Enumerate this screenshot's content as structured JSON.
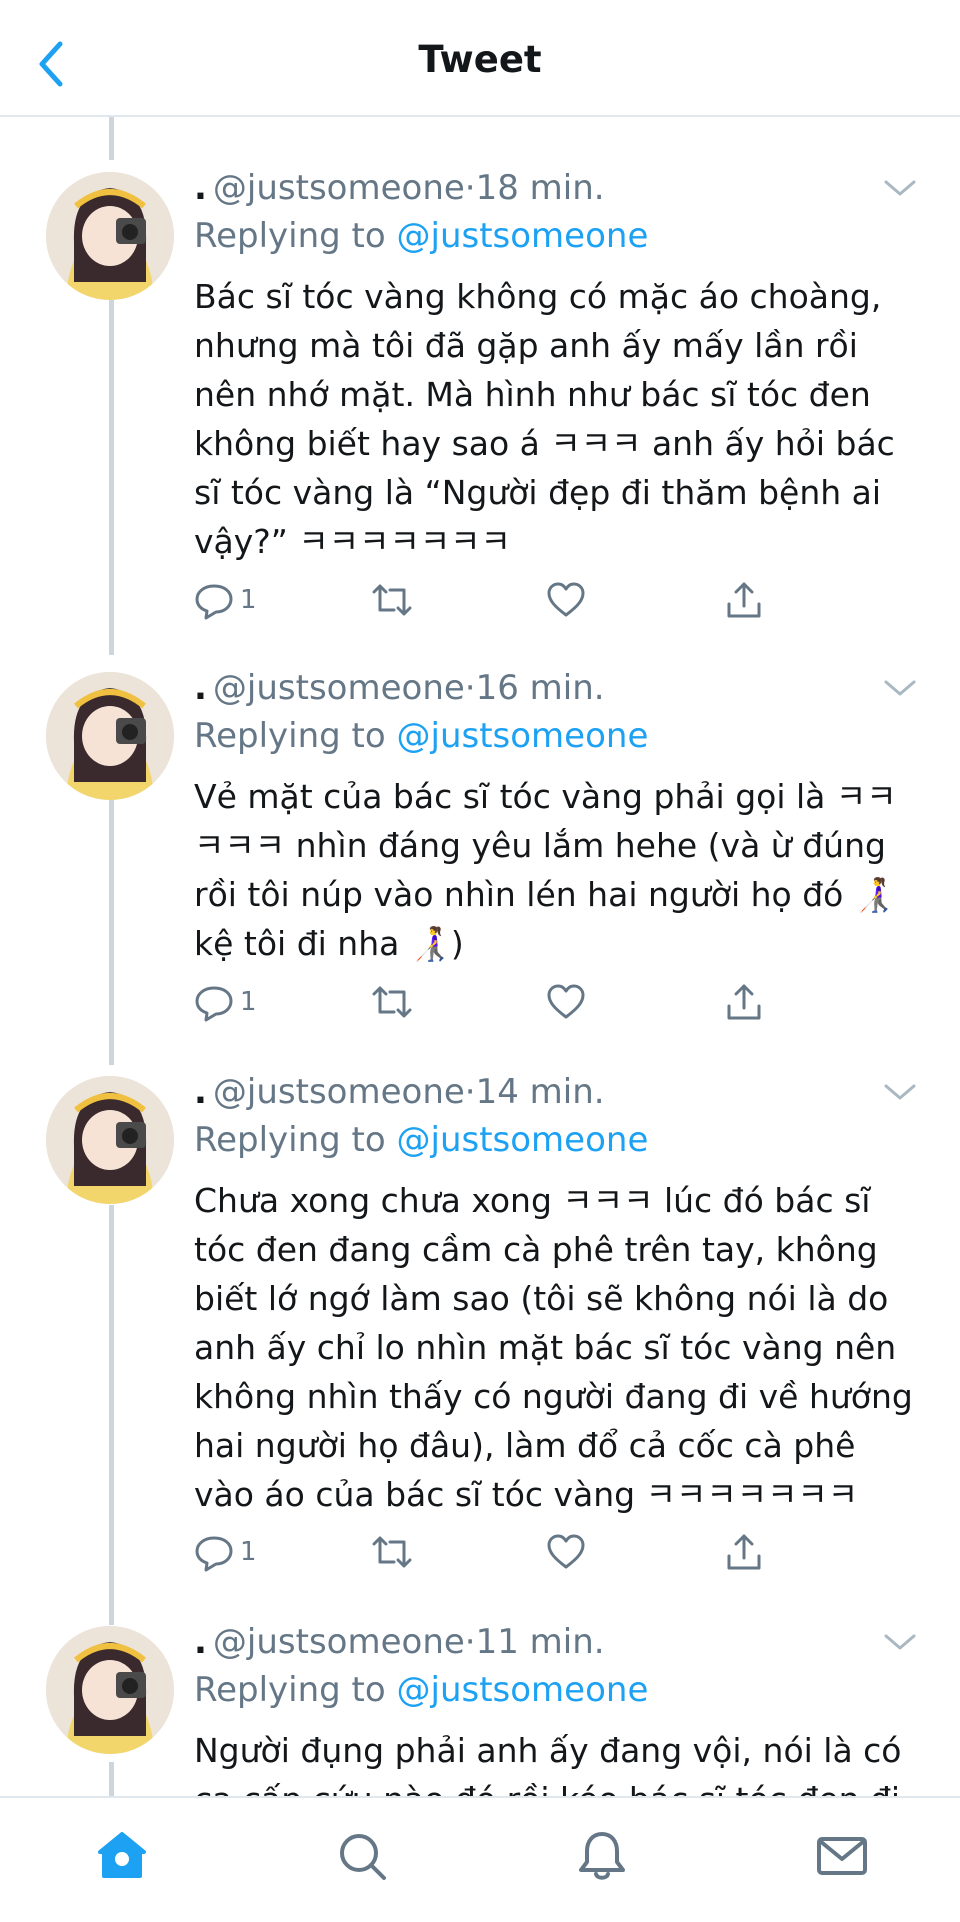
{
  "header": {
    "title": "Tweet"
  },
  "tweets": [
    {
      "dot": ".",
      "handle": "@justsomeone",
      "sep": "·",
      "time": "18 min.",
      "replying_prefix": "Replying to",
      "replying_handle": "@justsomeone",
      "text": "Bác sĩ tóc vàng không có mặc áo choàng, nhưng mà tôi đã gặp anh ấy mấy lần rồi nên nhớ mặt. Mà hình như bác sĩ tóc đen không biết hay sao á ㅋㅋㅋ anh ấy hỏi bác sĩ tóc vàng là “Người đẹp đi thăm bệnh ai vậy?” ㅋㅋㅋㅋㅋㅋㅋ",
      "reply_count": "1"
    },
    {
      "dot": ".",
      "handle": "@justsomeone",
      "sep": "·",
      "time": "16 min.",
      "replying_prefix": "Replying to",
      "replying_handle": "@justsomeone",
      "text": "Vẻ mặt của bác sĩ tóc vàng phải gọi là ㅋㅋㅋㅋㅋ nhìn đáng yêu lắm hehe (và ừ đúng rồi tôi núp vào nhìn lén hai người họ đó 👩‍🦯 kệ tôi đi nha 👩‍🦯)",
      "reply_count": "1"
    },
    {
      "dot": ".",
      "handle": "@justsomeone",
      "sep": "·",
      "time": "14 min.",
      "replying_prefix": "Replying to",
      "replying_handle": "@justsomeone",
      "text": "Chưa xong chưa xong ㅋㅋㅋ lúc đó bác sĩ tóc đen đang cầm cà phê trên tay, không biết lớ ngớ làm sao (tôi sẽ không nói là do anh ấy chỉ lo nhìn mặt bác sĩ tóc vàng nên không nhìn thấy có người đang đi về hướng hai người họ đâu), làm đổ cả cốc cà phê vào áo của bác sĩ tóc vàng ㅋㅋㅋㅋㅋㅋㅋ",
      "reply_count": "1"
    },
    {
      "dot": ".",
      "handle": "@justsomeone",
      "sep": "·",
      "time": "11 min.",
      "replying_prefix": "Replying to",
      "replying_handle": "@justsomeone",
      "text": "Người đụng phải anh ấy đang vội, nói là có ca cấp cứu nào đó rồi kéo bác sĩ tóc đen đi"
    }
  ],
  "icons": {
    "back": "chevron-left-icon",
    "more": "chevron-down-icon",
    "reply": "reply-icon",
    "retweet": "retweet-icon",
    "like": "heart-icon",
    "share": "share-icon",
    "home": "home-icon",
    "search": "search-icon",
    "notifications": "bell-icon",
    "messages": "mail-icon"
  },
  "colors": {
    "accent": "#1da1f2",
    "muted": "#657786",
    "text": "#14171a"
  }
}
